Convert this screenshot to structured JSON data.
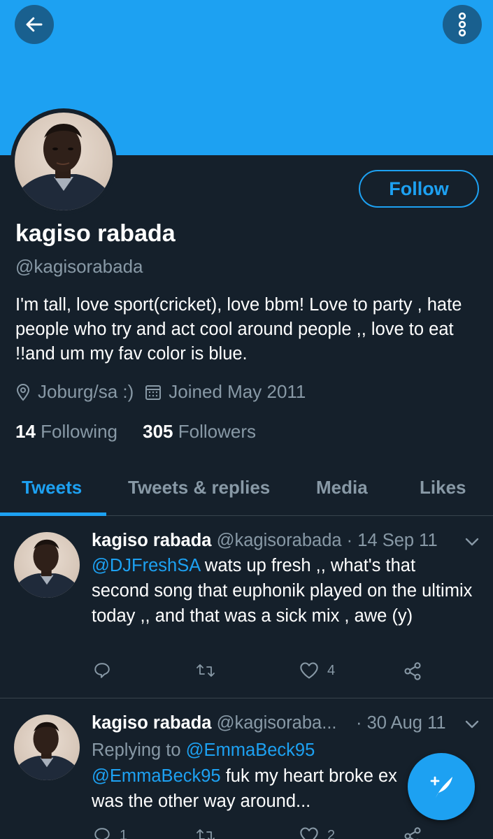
{
  "header": {
    "back_icon": "arrow-left-icon",
    "more_icon": "more-vertical-icon",
    "banner_color": "#1da1f2"
  },
  "profile": {
    "name": "kagiso rabada",
    "handle": "@kagisorabada",
    "follow_label": "Follow",
    "bio": "I'm tall, love sport(cricket), love bbm! Love to party , hate people who try and act cool around people ,, love to eat !!and um my fav color is blue.",
    "location": "Joburg/sa :)",
    "joined": "Joined May 2011",
    "following_count": "14",
    "following_label": "Following",
    "followers_count": "305",
    "followers_label": "Followers"
  },
  "tabs": [
    {
      "label": "Tweets",
      "active": true
    },
    {
      "label": "Tweets & replies",
      "active": false
    },
    {
      "label": "Media",
      "active": false
    },
    {
      "label": "Likes",
      "active": false
    }
  ],
  "tweets": [
    {
      "name": "kagiso rabada",
      "handle": "@kagisorabada",
      "separator": " · ",
      "date": "14 Sep 11",
      "mention": "@DJFreshSA",
      "text": " wats up fresh ,, what's that second song that euphonik played on the ultimix today ,, and that was a sick mix , awe (y)",
      "reply_count": "",
      "retweet_count": "",
      "like_count": "4"
    },
    {
      "name": "kagiso rabada",
      "handle": "@kagisoraba...",
      "separator": " · ",
      "date": "30 Aug 11",
      "replying_prefix": "Replying to ",
      "replying_to": "@EmmaBeck95",
      "mention": "@EmmaBeck95",
      "text": " fuk my heart broke ex",
      "text_line2": "was the other way around...",
      "reply_count": "1",
      "retweet_count": "",
      "like_count": "2"
    }
  ],
  "fab": {
    "icon": "compose-tweet-icon"
  },
  "colors": {
    "accent": "#1da1f2",
    "background": "#15202b",
    "secondary_text": "#8899a6",
    "divider": "#38444d"
  }
}
